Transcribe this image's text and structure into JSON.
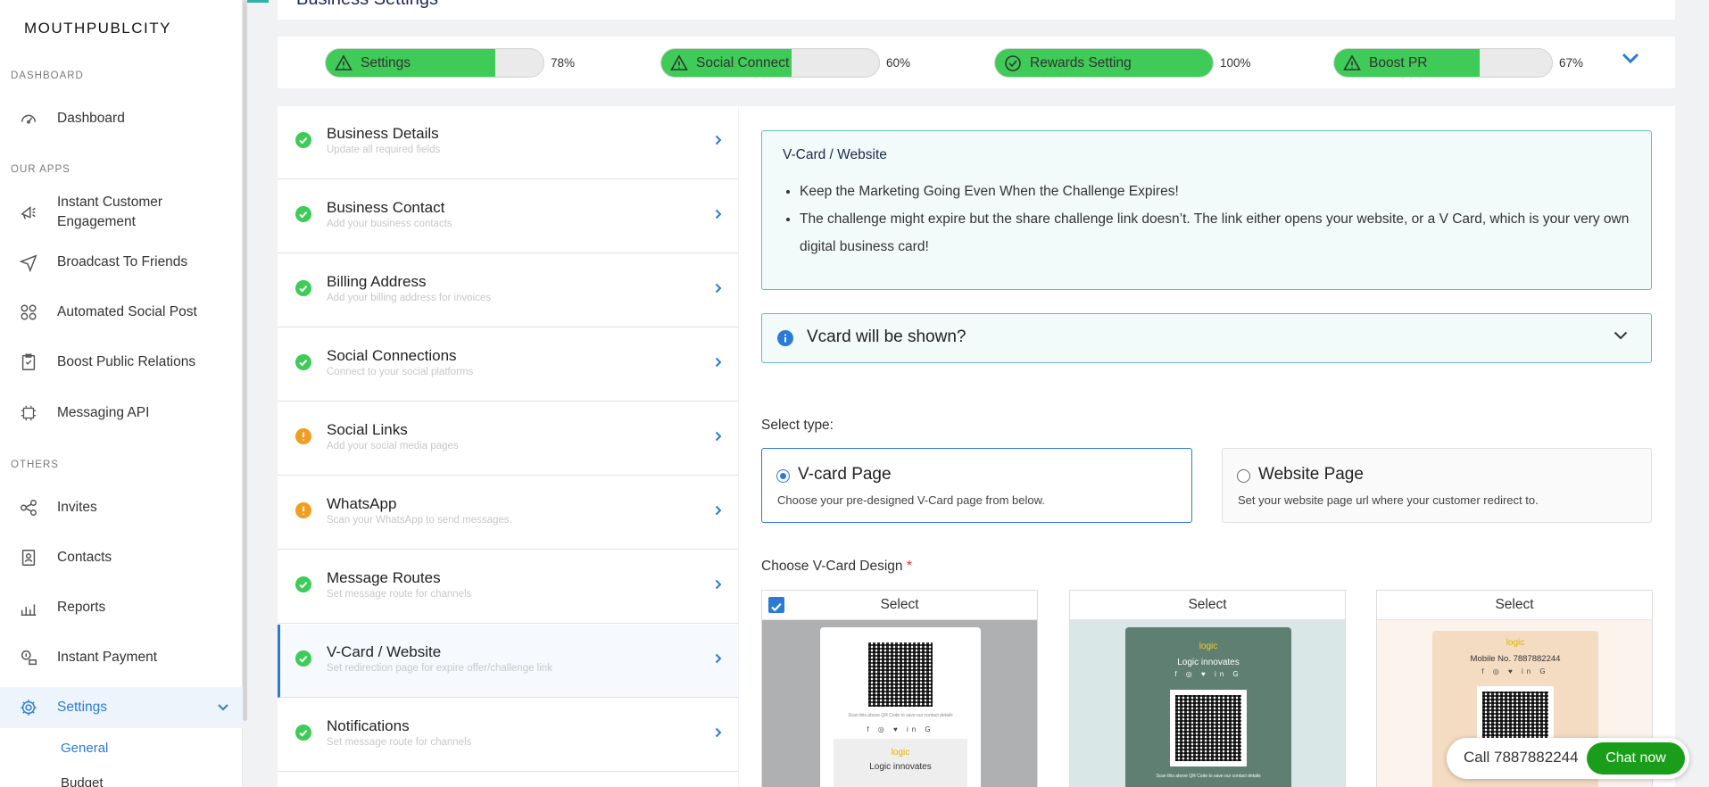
{
  "app": {
    "logo": "MOUTHPUBLCITY"
  },
  "sidebar": {
    "sections": [
      "DASHBOARD",
      "OUR APPS",
      "OTHERS"
    ],
    "items": [
      {
        "label": "Dashboard",
        "icon": "speedometer-icon"
      },
      {
        "label": "Instant Customer Engagement",
        "icon": "megaphone-icon"
      },
      {
        "label": "Broadcast To Friends",
        "icon": "send-icon"
      },
      {
        "label": "Automated Social Post",
        "icon": "social-grid-icon"
      },
      {
        "label": "Boost Public Relations",
        "icon": "clipboard-icon"
      },
      {
        "label": "Messaging API",
        "icon": "api-icon"
      },
      {
        "label": "Invites",
        "icon": "share-icon"
      },
      {
        "label": "Contacts",
        "icon": "contact-book-icon"
      },
      {
        "label": "Reports",
        "icon": "chart-icon"
      },
      {
        "label": "Instant Payment",
        "icon": "payment-icon"
      },
      {
        "label": "Settings",
        "icon": "gear-icon"
      }
    ],
    "sub_items": [
      "General",
      "Budget"
    ]
  },
  "header": {
    "title": "Business Settings"
  },
  "progress": [
    {
      "label": "Settings",
      "value": 78,
      "pct": "78%",
      "status": "warning"
    },
    {
      "label": "Social Connect",
      "value": 60,
      "pct": "60%",
      "status": "warning"
    },
    {
      "label": "Rewards Setting",
      "value": 100,
      "pct": "100%",
      "status": "complete"
    },
    {
      "label": "Boost PR",
      "value": 67,
      "pct": "67%",
      "status": "warning"
    }
  ],
  "settings_list": [
    {
      "title": "Business Details",
      "sub": "Update all required fields",
      "status": "complete"
    },
    {
      "title": "Business Contact",
      "sub": "Add your business contacts",
      "status": "complete"
    },
    {
      "title": "Billing Address",
      "sub": "Add your billing address for invoices",
      "status": "complete"
    },
    {
      "title": "Social Connections",
      "sub": "Connect to your social platforms",
      "status": "complete"
    },
    {
      "title": "Social Links",
      "sub": "Add your social media pages",
      "status": "pending"
    },
    {
      "title": "WhatsApp",
      "sub": "Scan your WhatsApp to send messages.",
      "status": "pending"
    },
    {
      "title": "Message Routes",
      "sub": "Set message route for channels",
      "status": "complete"
    },
    {
      "title": "V-Card / Website",
      "sub": "Set redirection page for expire offer/challenge link",
      "status": "complete"
    },
    {
      "title": "Notifications",
      "sub": "Set message route for channels",
      "status": "complete"
    }
  ],
  "panel": {
    "info_title": "V-Card / Website",
    "bullets": [
      "Keep the Marketing Going Even When the Challenge Expires!",
      "The challenge might expire but the share challenge link doesn’t. The link either opens your website, or a V Card, which is your very own digital business card!"
    ],
    "accordion": "Vcard will be shown?",
    "select_type_label": "Select type:",
    "options": [
      {
        "title": "V-card Page",
        "desc": "Choose your pre-designed V-Card page from below.",
        "selected": true
      },
      {
        "title": "Website Page",
        "desc": "Set your website page url where your customer redirect to.",
        "selected": false
      }
    ],
    "design_label": "Choose V-Card Design",
    "required_mark": "*",
    "cards": [
      {
        "select": "Select",
        "checked": true,
        "bg": "#aeb0b2",
        "scan_text": "Scan this above QR Code to save our contact details",
        "brand": "logic",
        "company": "Logic innovates"
      },
      {
        "select": "Select",
        "checked": false,
        "bg": "#d9e7e6",
        "brand": "logic",
        "company": "Logic innovates",
        "scan_text": "Scan this above QR Code to save our contact details"
      },
      {
        "select": "Select",
        "checked": false,
        "bg": "#fbf3ec",
        "brand": "logic",
        "mobile": "Mobile No. 7887882244"
      }
    ],
    "social_glyphs": "f ◎ ♥ in G"
  },
  "chat": {
    "phone": "Call 7887882244",
    "button": "Chat now"
  },
  "colors": {
    "accent": "#2b7bd6",
    "success": "#3ecb57",
    "warning": "#f29d1f",
    "chat": "#1a9e1a"
  }
}
